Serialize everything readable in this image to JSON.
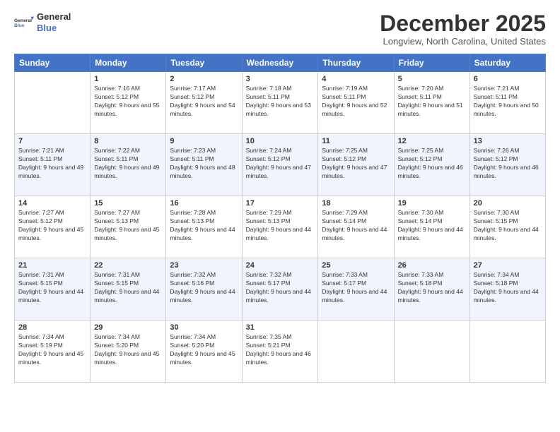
{
  "header": {
    "logo_line1": "General",
    "logo_line2": "Blue",
    "month_title": "December 2025",
    "location": "Longview, North Carolina, United States"
  },
  "days_of_week": [
    "Sunday",
    "Monday",
    "Tuesday",
    "Wednesday",
    "Thursday",
    "Friday",
    "Saturday"
  ],
  "weeks": [
    [
      {
        "day": "",
        "sunrise": "",
        "sunset": "",
        "daylight": ""
      },
      {
        "day": "1",
        "sunrise": "Sunrise: 7:16 AM",
        "sunset": "Sunset: 5:12 PM",
        "daylight": "Daylight: 9 hours and 55 minutes."
      },
      {
        "day": "2",
        "sunrise": "Sunrise: 7:17 AM",
        "sunset": "Sunset: 5:12 PM",
        "daylight": "Daylight: 9 hours and 54 minutes."
      },
      {
        "day": "3",
        "sunrise": "Sunrise: 7:18 AM",
        "sunset": "Sunset: 5:11 PM",
        "daylight": "Daylight: 9 hours and 53 minutes."
      },
      {
        "day": "4",
        "sunrise": "Sunrise: 7:19 AM",
        "sunset": "Sunset: 5:11 PM",
        "daylight": "Daylight: 9 hours and 52 minutes."
      },
      {
        "day": "5",
        "sunrise": "Sunrise: 7:20 AM",
        "sunset": "Sunset: 5:11 PM",
        "daylight": "Daylight: 9 hours and 51 minutes."
      },
      {
        "day": "6",
        "sunrise": "Sunrise: 7:21 AM",
        "sunset": "Sunset: 5:11 PM",
        "daylight": "Daylight: 9 hours and 50 minutes."
      }
    ],
    [
      {
        "day": "7",
        "sunrise": "Sunrise: 7:21 AM",
        "sunset": "Sunset: 5:11 PM",
        "daylight": "Daylight: 9 hours and 49 minutes."
      },
      {
        "day": "8",
        "sunrise": "Sunrise: 7:22 AM",
        "sunset": "Sunset: 5:11 PM",
        "daylight": "Daylight: 9 hours and 49 minutes."
      },
      {
        "day": "9",
        "sunrise": "Sunrise: 7:23 AM",
        "sunset": "Sunset: 5:11 PM",
        "daylight": "Daylight: 9 hours and 48 minutes."
      },
      {
        "day": "10",
        "sunrise": "Sunrise: 7:24 AM",
        "sunset": "Sunset: 5:12 PM",
        "daylight": "Daylight: 9 hours and 47 minutes."
      },
      {
        "day": "11",
        "sunrise": "Sunrise: 7:25 AM",
        "sunset": "Sunset: 5:12 PM",
        "daylight": "Daylight: 9 hours and 47 minutes."
      },
      {
        "day": "12",
        "sunrise": "Sunrise: 7:25 AM",
        "sunset": "Sunset: 5:12 PM",
        "daylight": "Daylight: 9 hours and 46 minutes."
      },
      {
        "day": "13",
        "sunrise": "Sunrise: 7:26 AM",
        "sunset": "Sunset: 5:12 PM",
        "daylight": "Daylight: 9 hours and 46 minutes."
      }
    ],
    [
      {
        "day": "14",
        "sunrise": "Sunrise: 7:27 AM",
        "sunset": "Sunset: 5:12 PM",
        "daylight": "Daylight: 9 hours and 45 minutes."
      },
      {
        "day": "15",
        "sunrise": "Sunrise: 7:27 AM",
        "sunset": "Sunset: 5:13 PM",
        "daylight": "Daylight: 9 hours and 45 minutes."
      },
      {
        "day": "16",
        "sunrise": "Sunrise: 7:28 AM",
        "sunset": "Sunset: 5:13 PM",
        "daylight": "Daylight: 9 hours and 44 minutes."
      },
      {
        "day": "17",
        "sunrise": "Sunrise: 7:29 AM",
        "sunset": "Sunset: 5:13 PM",
        "daylight": "Daylight: 9 hours and 44 minutes."
      },
      {
        "day": "18",
        "sunrise": "Sunrise: 7:29 AM",
        "sunset": "Sunset: 5:14 PM",
        "daylight": "Daylight: 9 hours and 44 minutes."
      },
      {
        "day": "19",
        "sunrise": "Sunrise: 7:30 AM",
        "sunset": "Sunset: 5:14 PM",
        "daylight": "Daylight: 9 hours and 44 minutes."
      },
      {
        "day": "20",
        "sunrise": "Sunrise: 7:30 AM",
        "sunset": "Sunset: 5:15 PM",
        "daylight": "Daylight: 9 hours and 44 minutes."
      }
    ],
    [
      {
        "day": "21",
        "sunrise": "Sunrise: 7:31 AM",
        "sunset": "Sunset: 5:15 PM",
        "daylight": "Daylight: 9 hours and 44 minutes."
      },
      {
        "day": "22",
        "sunrise": "Sunrise: 7:31 AM",
        "sunset": "Sunset: 5:15 PM",
        "daylight": "Daylight: 9 hours and 44 minutes."
      },
      {
        "day": "23",
        "sunrise": "Sunrise: 7:32 AM",
        "sunset": "Sunset: 5:16 PM",
        "daylight": "Daylight: 9 hours and 44 minutes."
      },
      {
        "day": "24",
        "sunrise": "Sunrise: 7:32 AM",
        "sunset": "Sunset: 5:17 PM",
        "daylight": "Daylight: 9 hours and 44 minutes."
      },
      {
        "day": "25",
        "sunrise": "Sunrise: 7:33 AM",
        "sunset": "Sunset: 5:17 PM",
        "daylight": "Daylight: 9 hours and 44 minutes."
      },
      {
        "day": "26",
        "sunrise": "Sunrise: 7:33 AM",
        "sunset": "Sunset: 5:18 PM",
        "daylight": "Daylight: 9 hours and 44 minutes."
      },
      {
        "day": "27",
        "sunrise": "Sunrise: 7:34 AM",
        "sunset": "Sunset: 5:18 PM",
        "daylight": "Daylight: 9 hours and 44 minutes."
      }
    ],
    [
      {
        "day": "28",
        "sunrise": "Sunrise: 7:34 AM",
        "sunset": "Sunset: 5:19 PM",
        "daylight": "Daylight: 9 hours and 45 minutes."
      },
      {
        "day": "29",
        "sunrise": "Sunrise: 7:34 AM",
        "sunset": "Sunset: 5:20 PM",
        "daylight": "Daylight: 9 hours and 45 minutes."
      },
      {
        "day": "30",
        "sunrise": "Sunrise: 7:34 AM",
        "sunset": "Sunset: 5:20 PM",
        "daylight": "Daylight: 9 hours and 45 minutes."
      },
      {
        "day": "31",
        "sunrise": "Sunrise: 7:35 AM",
        "sunset": "Sunset: 5:21 PM",
        "daylight": "Daylight: 9 hours and 46 minutes."
      },
      {
        "day": "",
        "sunrise": "",
        "sunset": "",
        "daylight": ""
      },
      {
        "day": "",
        "sunrise": "",
        "sunset": "",
        "daylight": ""
      },
      {
        "day": "",
        "sunrise": "",
        "sunset": "",
        "daylight": ""
      }
    ]
  ]
}
